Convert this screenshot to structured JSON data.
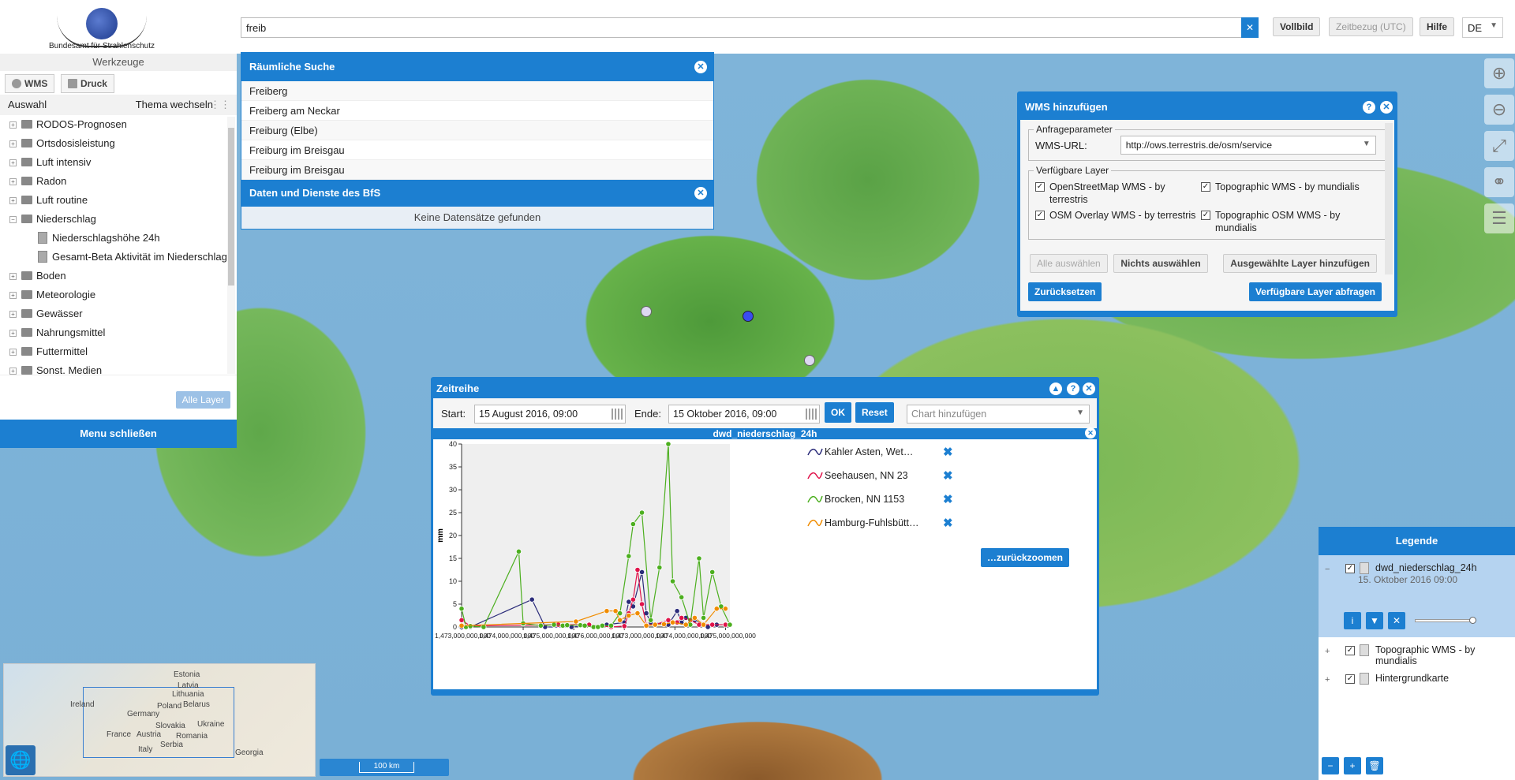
{
  "header": {
    "logo_text": "Bundesamt für Strahlenschutz",
    "search_value": "freib",
    "buttons": {
      "vollbild": "Vollbild",
      "zeitbezug": "Zeitbezug (UTC)",
      "hilfe": "Hilfe"
    },
    "language": "DE"
  },
  "left_panel": {
    "title": "Werkzeuge",
    "tools": {
      "wms": "WMS",
      "druck": "Druck"
    },
    "auswahl": "Auswahl",
    "thema": "Thema wechseln",
    "tree": [
      {
        "label": "RODOS-Prognosen",
        "type": "folder",
        "sign": "+"
      },
      {
        "label": "Ortsdosisleistung",
        "type": "folder",
        "sign": "+"
      },
      {
        "label": "Luft intensiv",
        "type": "folder",
        "sign": "+"
      },
      {
        "label": "Radon",
        "type": "folder",
        "sign": "+"
      },
      {
        "label": "Luft routine",
        "type": "folder",
        "sign": "+"
      },
      {
        "label": "Niederschlag",
        "type": "folder",
        "sign": "−"
      },
      {
        "label": "Niederschlagshöhe 24h",
        "type": "doc"
      },
      {
        "label": "Gesamt-Beta Aktivität im Niederschlag",
        "type": "doc"
      },
      {
        "label": "Boden",
        "type": "folder",
        "sign": "+"
      },
      {
        "label": "Meteorologie",
        "type": "folder",
        "sign": "+"
      },
      {
        "label": "Gewässer",
        "type": "folder",
        "sign": "+"
      },
      {
        "label": "Nahrungsmittel",
        "type": "folder",
        "sign": "+"
      },
      {
        "label": "Futtermittel",
        "type": "folder",
        "sign": "+"
      },
      {
        "label": "Sonst. Medien",
        "type": "folder",
        "sign": "+"
      }
    ],
    "alle_layer": "Alle Layer",
    "menu_close": "Menu schließen"
  },
  "search_results": {
    "title": "Räumliche Suche",
    "items": [
      "Freiberg",
      "Freiberg am Neckar",
      "Freiburg (Elbe)",
      "Freiburg im Breisgau",
      "Freiburg im Breisgau"
    ],
    "services_title": "Daten und Dienste des BfS",
    "services_empty": "Keine Datensätze gefunden"
  },
  "wms_dialog": {
    "title": "WMS hinzufügen",
    "params_legend": "Anfrageparameter",
    "url_label": "WMS-URL:",
    "url_value": "http://ows.terrestris.de/osm/service",
    "layers_legend": "Verfügbare Layer",
    "layers": [
      "OpenStreetMap WMS - by terrestris",
      "Topographic WMS - by mundialis",
      "OSM Overlay WMS - by terrestris",
      "Topographic OSM WMS - by mundialis"
    ],
    "select_all": "Alle auswählen",
    "select_none": "Nichts auswählen",
    "add_selected": "Ausgewählte Layer hinzufügen",
    "reset": "Zurücksetzen",
    "query": "Verfügbare Layer abfragen"
  },
  "timeseries": {
    "title": "Zeitreihe",
    "start_label": "Start:",
    "start_value": "15 August 2016, 09:00",
    "end_label": "Ende:",
    "end_value": "15 Oktober 2016, 09:00",
    "ok": "OK",
    "reset": "Reset",
    "chart_add": "Chart hinzufügen",
    "zoom_back": "…zurückzoomen",
    "legend": [
      {
        "name": "Kahler Asten, Wet…",
        "color": "#2b2c7a"
      },
      {
        "name": "Seehausen, NN 23",
        "color": "#e0134a"
      },
      {
        "name": "Brocken, NN 1153",
        "color": "#4caf1f"
      },
      {
        "name": "Hamburg-Fuhlsbütt…",
        "color": "#f08c00"
      }
    ]
  },
  "chart_data": {
    "type": "line",
    "title": "dwd_niederschlag_24h",
    "ylabel": "mm",
    "ylim": [
      0,
      40
    ],
    "yticks": [
      0,
      5,
      10,
      15,
      20,
      25,
      30,
      35,
      40
    ],
    "xtick_labels": [
      "1,473,000,000,000",
      "1,474,000,000,000",
      "1,475,000,000,000",
      "1,476,000,000,000"
    ],
    "x_days_range": [
      0,
      61
    ],
    "series": [
      {
        "name": "Kahler Asten, Wet…",
        "color": "#2b2c7a",
        "points": [
          [
            0,
            0
          ],
          [
            2,
            0
          ],
          [
            16,
            6
          ],
          [
            19,
            0
          ],
          [
            25,
            0
          ],
          [
            33,
            0.5
          ],
          [
            37,
            1
          ],
          [
            38,
            5.5
          ],
          [
            39,
            4.5
          ],
          [
            41,
            12
          ],
          [
            42,
            3
          ],
          [
            43,
            1
          ],
          [
            47,
            0.5
          ],
          [
            49,
            3.5
          ],
          [
            50,
            1
          ],
          [
            51,
            2
          ],
          [
            53,
            1.5
          ],
          [
            56,
            0
          ],
          [
            58,
            0.5
          ]
        ]
      },
      {
        "name": "Seehausen, NN 23",
        "color": "#e0134a",
        "points": [
          [
            0,
            1.5
          ],
          [
            2,
            0.2
          ],
          [
            22,
            0.5
          ],
          [
            29,
            0.5
          ],
          [
            34,
            0
          ],
          [
            37,
            0.2
          ],
          [
            38,
            3
          ],
          [
            39,
            6
          ],
          [
            40,
            12.5
          ],
          [
            41,
            5
          ],
          [
            42,
            0.5
          ],
          [
            44,
            0.5
          ],
          [
            47,
            1.5
          ],
          [
            49,
            1
          ],
          [
            50,
            2
          ],
          [
            52,
            1.5
          ],
          [
            54,
            0.5
          ],
          [
            57,
            0.5
          ],
          [
            60,
            0.5
          ]
        ]
      },
      {
        "name": "Brocken, NN 1153",
        "color": "#4caf1f",
        "points": [
          [
            0,
            4
          ],
          [
            1,
            0
          ],
          [
            2,
            0.2
          ],
          [
            5,
            0
          ],
          [
            13,
            16.5
          ],
          [
            14,
            0.8
          ],
          [
            18,
            0.3
          ],
          [
            21,
            0.5
          ],
          [
            23,
            0.3
          ],
          [
            24,
            0.4
          ],
          [
            27,
            0.4
          ],
          [
            28,
            0.3
          ],
          [
            30,
            0
          ],
          [
            31,
            0
          ],
          [
            32,
            0.3
          ],
          [
            34,
            0.3
          ],
          [
            36,
            3
          ],
          [
            38,
            15.5
          ],
          [
            39,
            22.5
          ],
          [
            41,
            25
          ],
          [
            43,
            1.5
          ],
          [
            45,
            13
          ],
          [
            47,
            40
          ],
          [
            48,
            10
          ],
          [
            50,
            6.5
          ],
          [
            52,
            0.5
          ],
          [
            54,
            15
          ],
          [
            55,
            2
          ],
          [
            57,
            12
          ],
          [
            59,
            4.5
          ],
          [
            61,
            0.5
          ]
        ]
      },
      {
        "name": "Hamburg-Fuhlsbütt…",
        "color": "#f08c00",
        "points": [
          [
            0,
            0.3
          ],
          [
            26,
            1.2
          ],
          [
            33,
            3.5
          ],
          [
            35,
            3.5
          ],
          [
            36,
            1.5
          ],
          [
            38,
            2.5
          ],
          [
            40,
            3
          ],
          [
            42,
            0.3
          ],
          [
            44,
            0.5
          ],
          [
            46,
            0.6
          ],
          [
            48,
            1
          ],
          [
            51,
            0.5
          ],
          [
            53,
            2
          ],
          [
            55,
            0.5
          ],
          [
            58,
            4
          ],
          [
            60,
            4
          ]
        ]
      }
    ]
  },
  "legend_panel": {
    "title": "Legende",
    "layers": [
      {
        "name": "dwd_niederschlag_24h",
        "date": "15. Oktober 2016 09:00",
        "sign": "−"
      },
      {
        "name": "Topographic WMS - by mundialis",
        "sign": "+"
      },
      {
        "name": "Hintergrundkarte",
        "sign": "+"
      }
    ]
  },
  "overview": {
    "labels": [
      "Estonia",
      "Latvia",
      "Lithuania",
      "Ireland",
      "Belarus",
      "Poland",
      "Germany",
      "Ukraine",
      "Slovakia",
      "France",
      "Austria",
      "Romania",
      "Italy",
      "Serbia",
      "Georgia"
    ]
  },
  "scale": "100 km"
}
